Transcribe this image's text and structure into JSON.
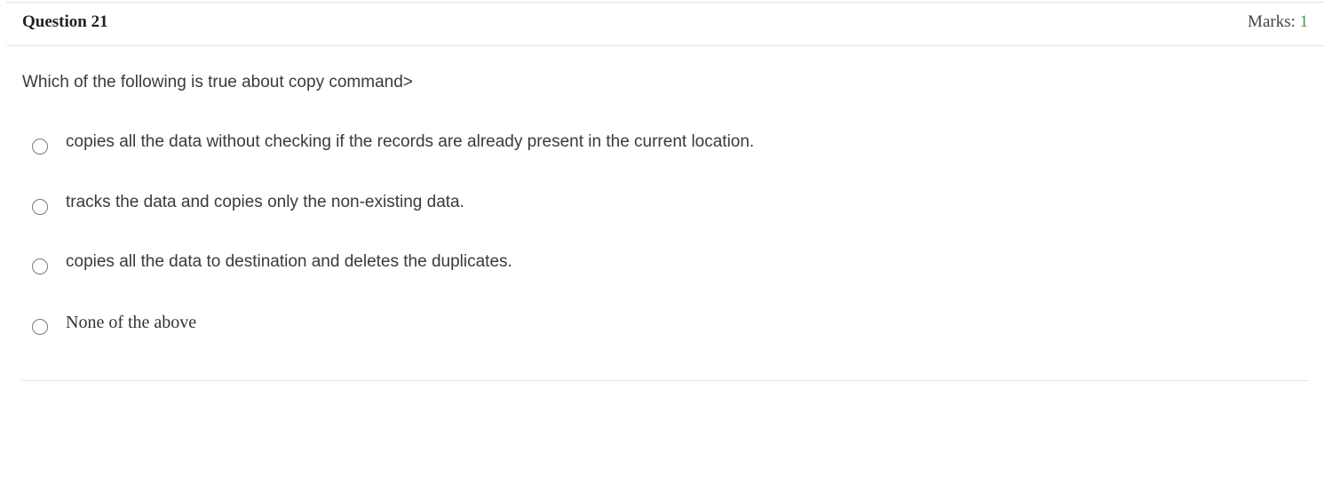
{
  "header": {
    "question_label": "Question 21",
    "marks_label": "Marks: ",
    "marks_value": "1"
  },
  "question": {
    "text": "Which of the following is true about copy command>"
  },
  "options": [
    {
      "label": "copies all the data without checking if the records are already present in the current location.",
      "selected": false
    },
    {
      "label": "tracks the data and copies only the non-existing data.",
      "selected": false
    },
    {
      "label": "copies all the data to destination and deletes the duplicates.",
      "selected": false
    },
    {
      "label": "None of the above",
      "selected": false
    }
  ],
  "colors": {
    "marks_value": "#3c9b4a",
    "text": "#3a3a3a",
    "divider": "#e3e3e3"
  }
}
